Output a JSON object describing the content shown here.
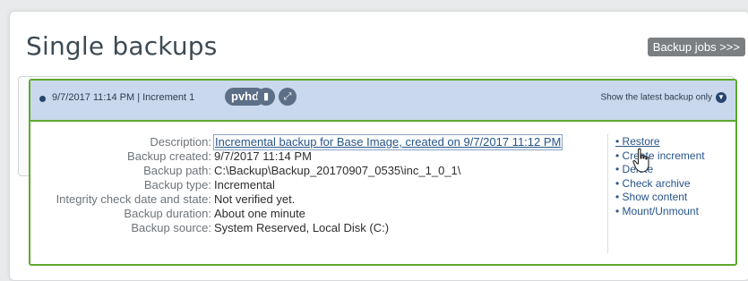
{
  "page": {
    "title": "Single backups",
    "backup_jobs_button": "Backup jobs >>>"
  },
  "backup": {
    "header": "9/7/2017 11:14 PM | Increment 1",
    "format_tag": "pvhd",
    "icons": [
      "disk-icon",
      "expand-icon"
    ],
    "latest_only_toggle": "Show the latest backup only",
    "details": [
      {
        "label": "Description:",
        "value": "Incremental backup for Base Image, created on 9/7/2017 11:12 PM"
      },
      {
        "label": "Backup created:",
        "value": "9/7/2017 11:14 PM"
      },
      {
        "label": "Backup path:",
        "value": "C:\\Backup\\Backup_20170907_0535\\inc_1_0_1\\"
      },
      {
        "label": "Backup type:",
        "value": "Incremental"
      },
      {
        "label": "Integrity check date and state:",
        "value": "Not verified yet."
      },
      {
        "label": "Backup duration:",
        "value": "About one minute"
      },
      {
        "label": "Backup source:",
        "value": "System Reserved, Local Disk (C:)"
      }
    ],
    "actions": [
      "Restore",
      "Create increment",
      "Delete",
      "Check archive",
      "Show content",
      "Mount/Unmount"
    ]
  },
  "colors": {
    "accent_green": "#5fa82c",
    "header_blue": "#c9d8ec",
    "link_blue": "#26548a"
  }
}
